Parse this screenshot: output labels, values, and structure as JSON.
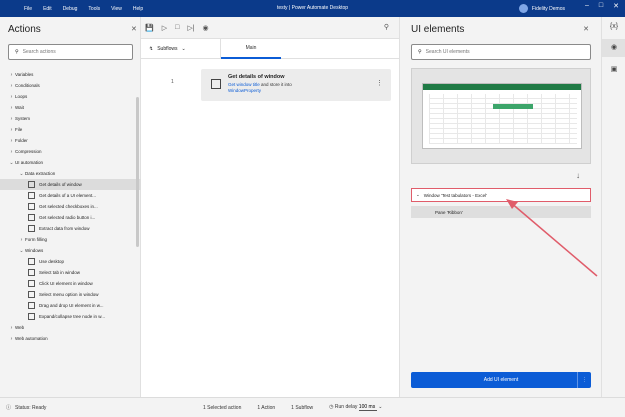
{
  "window": {
    "title": "testy | Power Automate Desktop",
    "menu": [
      "File",
      "Edit",
      "Debug",
      "Tools",
      "View",
      "Help"
    ],
    "user": "Fidelity Demos"
  },
  "actions_pane": {
    "title": "Actions",
    "search_placeholder": "Search actions",
    "tree": [
      {
        "label": "Variables",
        "level": 0,
        "expanded": false
      },
      {
        "label": "Conditionals",
        "level": 0,
        "expanded": false
      },
      {
        "label": "Loops",
        "level": 0,
        "expanded": false
      },
      {
        "label": "Wait",
        "level": 0,
        "expanded": false
      },
      {
        "label": "System",
        "level": 0,
        "expanded": false
      },
      {
        "label": "File",
        "level": 0,
        "expanded": false
      },
      {
        "label": "Folder",
        "level": 0,
        "expanded": false
      },
      {
        "label": "Compression",
        "level": 0,
        "expanded": false
      },
      {
        "label": "UI automation",
        "level": 0,
        "expanded": true
      },
      {
        "label": "Data extraction",
        "level": 1,
        "expanded": true
      },
      {
        "label": "Get details of window",
        "level": 2,
        "selected": true
      },
      {
        "label": "Get details of a UI element...",
        "level": 2
      },
      {
        "label": "Get selected checkboxes in...",
        "level": 2
      },
      {
        "label": "Get selected radio button i...",
        "level": 2
      },
      {
        "label": "Extract data from window",
        "level": 2
      },
      {
        "label": "Form filling",
        "level": 1,
        "expanded": false
      },
      {
        "label": "Windows",
        "level": 1,
        "expanded": true
      },
      {
        "label": "Use desktop",
        "level": 2
      },
      {
        "label": "Select tab in window",
        "level": 2
      },
      {
        "label": "Click UI element in window",
        "level": 2
      },
      {
        "label": "Select menu option in window",
        "level": 2
      },
      {
        "label": "Drag and drop UI element in w...",
        "level": 2
      },
      {
        "label": "Expand/collapse tree node in w...",
        "level": 2
      },
      {
        "label": "Web",
        "level": 0,
        "expanded": false
      },
      {
        "label": "Web automation",
        "level": 0,
        "expanded": false
      }
    ]
  },
  "designer": {
    "subflows_label": "Subflows",
    "main_tab": "Main",
    "line_number": "1",
    "action": {
      "title": "Get details of window",
      "desc_link": "Get window title",
      "desc_rest": "and store it into",
      "variable": "WindowProperty"
    }
  },
  "ui_pane": {
    "title": "UI elements",
    "search_placeholder": "Search UI elements",
    "item": "Window 'Test tabulators - Excel'",
    "child": "Pane 'Ribbon'",
    "add_button": "Add UI element"
  },
  "status": {
    "ready": "Status: Ready",
    "selected": "1 Selected action",
    "actions": "1 Action",
    "subflows": "1 Subflow",
    "run_delay_label": "Run delay",
    "run_delay_value": "100 ms"
  },
  "colors": {
    "titlebar": "#0b3a8a",
    "accent": "#0b5cd6",
    "highlight_border": "#e05c6a",
    "arrow": "#e05c6a"
  }
}
